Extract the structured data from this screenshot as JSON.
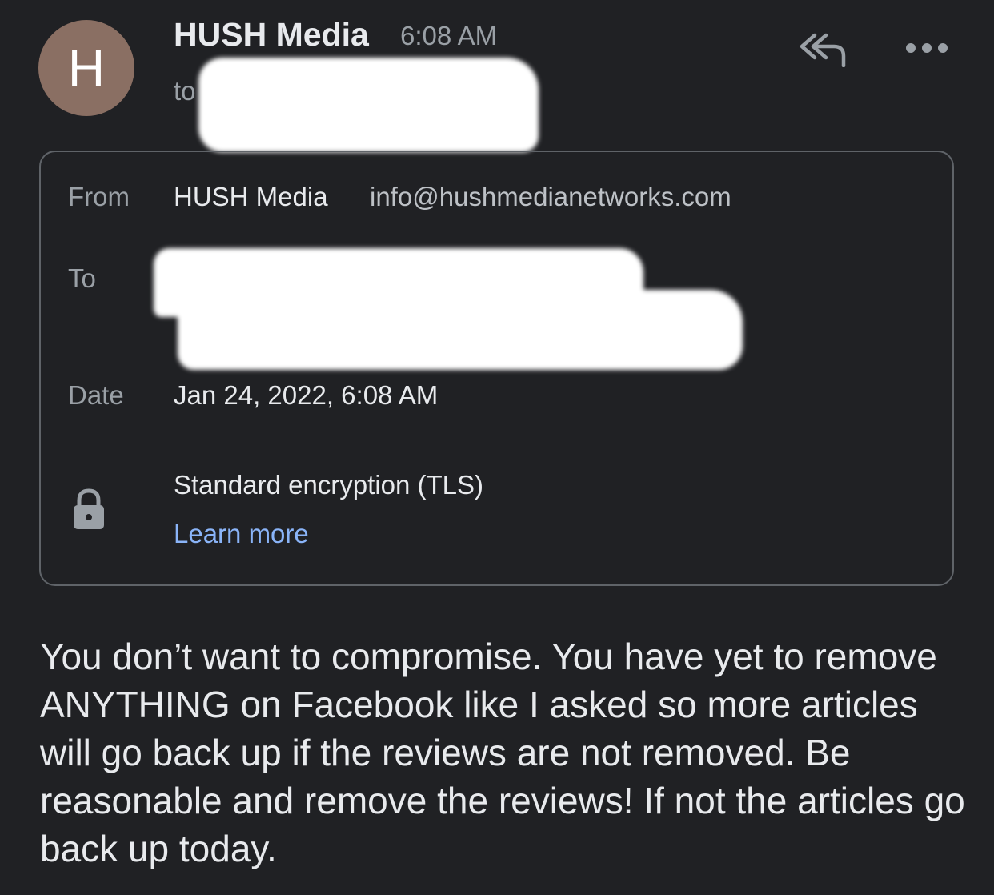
{
  "header": {
    "avatar_letter": "H",
    "sender_name": "HUSH Media",
    "time": "6:08 AM",
    "to_prefix": "to",
    "reply_all_icon": "reply-all-icon",
    "more_icon": "more-horizontal-icon"
  },
  "details": {
    "from_label": "From",
    "from_name": "HUSH Media",
    "from_email": "info@hushmedianetworks.com",
    "to_label": "To",
    "date_label": "Date",
    "date_value": "Jan 24, 2022, 6:08 AM",
    "security_icon": "lock-icon",
    "encryption_text": "Standard encryption (TLS)",
    "learn_more": "Learn more"
  },
  "message": {
    "body": "You don’t want to compromise. You have yet to remove ANYTHING on Facebook like I asked so more articles will go back up if the reviews are not removed. Be reasonable and remove the reviews! If not the articles go back up today."
  },
  "colors": {
    "background": "#202124",
    "avatar": "#8a6f63",
    "link": "#8ab4f8",
    "border": "#5f6368"
  }
}
